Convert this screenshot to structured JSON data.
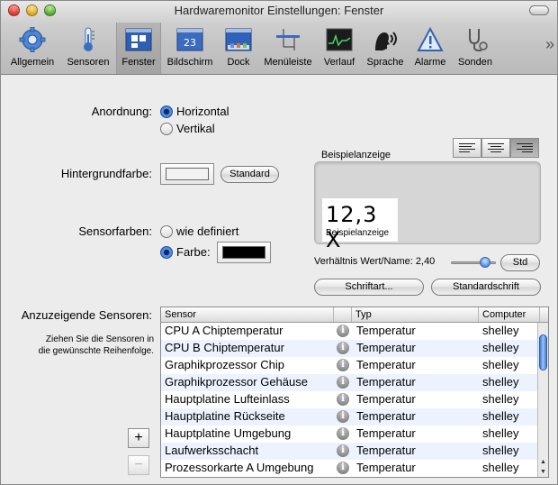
{
  "window": {
    "title": "Hardwaremonitor Einstellungen: Fenster"
  },
  "toolbar": {
    "items": [
      {
        "label": "Allgemein",
        "icon": "gear-icon"
      },
      {
        "label": "Sensoren",
        "icon": "thermometer-icon"
      },
      {
        "label": "Fenster",
        "icon": "window-icon"
      },
      {
        "label": "Bildschirm",
        "icon": "calendar-screen-icon"
      },
      {
        "label": "Dock",
        "icon": "dock-icon"
      },
      {
        "label": "Menüleiste",
        "icon": "menubar-icon"
      },
      {
        "label": "Verlauf",
        "icon": "graph-icon"
      },
      {
        "label": "Sprache",
        "icon": "speech-icon"
      },
      {
        "label": "Alarme",
        "icon": "warning-icon"
      },
      {
        "label": "Sonden",
        "icon": "stethoscope-icon"
      }
    ],
    "selected": "Fenster",
    "overflow": "»"
  },
  "anordnung": {
    "label": "Anordnung:",
    "horizontal": "Horizontal",
    "vertikal": "Vertikal",
    "selected": "Horizontal"
  },
  "hintergrund": {
    "label": "Hintergrundfarbe:",
    "button": "Standard",
    "color": "#f2f2f2"
  },
  "sensorfarben": {
    "label": "Sensorfarben:",
    "option_defined": "wie definiert",
    "option_farbe": "Farbe:",
    "selected": "Farbe:",
    "color": "#000000"
  },
  "preview": {
    "label": "Beispielanzeige",
    "value": "12,3 X",
    "caption": "Beispielanzeige",
    "alignment": "right"
  },
  "ratio": {
    "label": "Verhältnis Wert/Name: 2,40",
    "value": 2.4,
    "button": "Std"
  },
  "fonts": {
    "font_button": "Schriftart...",
    "default_button": "Standardschrift"
  },
  "sensors": {
    "label": "Anzuzeigende Sensoren:",
    "hint_line1": "Ziehen Sie die Sensoren in",
    "hint_line2": "die gewünschte Reihenfolge.",
    "columns": [
      "Sensor",
      "Typ",
      "Computer"
    ],
    "rows": [
      {
        "sensor": "CPU A Chiptemperatur",
        "typ": "Temperatur",
        "computer": "shelley"
      },
      {
        "sensor": "CPU B Chiptemperatur",
        "typ": "Temperatur",
        "computer": "shelley"
      },
      {
        "sensor": "Graphikprozessor Chip",
        "typ": "Temperatur",
        "computer": "shelley"
      },
      {
        "sensor": "Graphikprozessor Gehäuse",
        "typ": "Temperatur",
        "computer": "shelley"
      },
      {
        "sensor": "Hauptplatine Lufteinlass",
        "typ": "Temperatur",
        "computer": "shelley"
      },
      {
        "sensor": "Hauptplatine Rückseite",
        "typ": "Temperatur",
        "computer": "shelley"
      },
      {
        "sensor": "Hauptplatine Umgebung",
        "typ": "Temperatur",
        "computer": "shelley"
      },
      {
        "sensor": "Laufwerksschacht",
        "typ": "Temperatur",
        "computer": "shelley"
      },
      {
        "sensor": "Prozessorkarte A Umgebung",
        "typ": "Temperatur",
        "computer": "shelley"
      }
    ],
    "add": "+",
    "remove": "−"
  }
}
